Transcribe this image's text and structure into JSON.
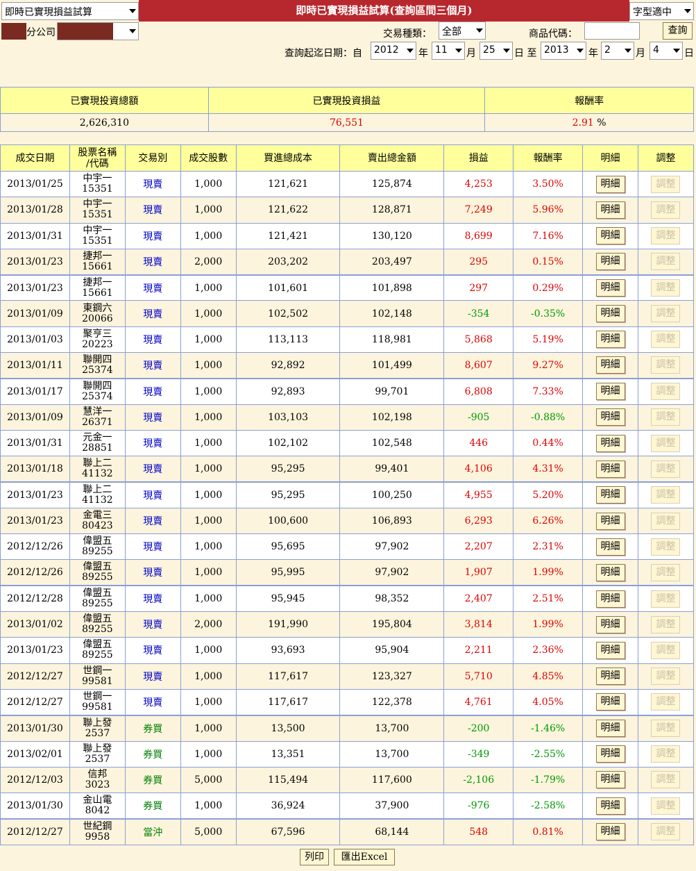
{
  "header": {
    "func_select": "即時已實現損益試算",
    "title": "即時已實現損益試算(查詢區間三個月)",
    "font_select": "字型適中",
    "branch_suffix": "分公司",
    "trade_type_label": "交易種類：",
    "trade_type_value": "全部",
    "product_code_label": "商品代碼：",
    "product_code_value": "",
    "query_button": "查詢",
    "date_label": "查詢起迄日期：自",
    "from_year": "2012",
    "year_unit_1": "年",
    "from_month": "11",
    "month_unit_1": "月",
    "from_day": "25",
    "day_unit_1": "日 至",
    "to_year": "2013",
    "year_unit_2": "年",
    "to_month": "2",
    "month_unit_2": "月",
    "to_day": "4",
    "day_unit_2": "日"
  },
  "summary": {
    "h_total": "已實現投資總額",
    "h_pl": "已實現投資損益",
    "h_rate": "報酬率",
    "total": "2,626,310",
    "pl": "76,551",
    "rate": "2.91",
    "rate_unit": "%"
  },
  "table": {
    "headers": [
      "成交日期",
      "股票名稱\n/代碼",
      "交易別",
      "成交股數",
      "買進總成本",
      "賣出總金額",
      "損益",
      "報酬率",
      "明細",
      "調整"
    ],
    "detail_label": "明細",
    "adjust_label": "調整",
    "rows": [
      [
        "2013/01/25",
        "中宇一",
        "15351",
        "現賣",
        "1,000",
        "121,621",
        "125,874",
        "4,253",
        "3.50%",
        "up"
      ],
      [
        "2013/01/28",
        "中宇一",
        "15351",
        "現賣",
        "1,000",
        "121,622",
        "128,871",
        "7,249",
        "5.96%",
        "up"
      ],
      [
        "2013/01/31",
        "中宇一",
        "15351",
        "現賣",
        "1,000",
        "121,421",
        "130,120",
        "8,699",
        "7.16%",
        "up"
      ],
      [
        "2013/01/23",
        "捷邦一",
        "15661",
        "現賣",
        "2,000",
        "203,202",
        "203,497",
        "295",
        "0.15%",
        "up"
      ],
      [
        "2013/01/23",
        "捷邦一",
        "15661",
        "現賣",
        "1,000",
        "101,601",
        "101,898",
        "297",
        "0.29%",
        "up"
      ],
      [
        "2013/01/09",
        "東鋼六",
        "20066",
        "現賣",
        "1,000",
        "102,502",
        "102,148",
        "-354",
        "-0.35%",
        "down"
      ],
      [
        "2013/01/03",
        "聚亨三",
        "20223",
        "現賣",
        "1,000",
        "113,113",
        "118,981",
        "5,868",
        "5.19%",
        "up"
      ],
      [
        "2013/01/11",
        "聯開四",
        "25374",
        "現賣",
        "1,000",
        "92,892",
        "101,499",
        "8,607",
        "9.27%",
        "up"
      ],
      [
        "2013/01/17",
        "聯開四",
        "25374",
        "現賣",
        "1,000",
        "92,893",
        "99,701",
        "6,808",
        "7.33%",
        "up"
      ],
      [
        "2013/01/09",
        "慧洋一",
        "26371",
        "現賣",
        "1,000",
        "103,103",
        "102,198",
        "-905",
        "-0.88%",
        "down"
      ],
      [
        "2013/01/31",
        "元金一",
        "28851",
        "現賣",
        "1,000",
        "102,102",
        "102,548",
        "446",
        "0.44%",
        "up"
      ],
      [
        "2013/01/18",
        "聯上二",
        "41132",
        "現賣",
        "1,000",
        "95,295",
        "99,401",
        "4,106",
        "4.31%",
        "up"
      ],
      [
        "2013/01/23",
        "聯上二",
        "41132",
        "現賣",
        "1,000",
        "95,295",
        "100,250",
        "4,955",
        "5.20%",
        "up"
      ],
      [
        "2013/01/23",
        "金電三",
        "80423",
        "現賣",
        "1,000",
        "100,600",
        "106,893",
        "6,293",
        "6.26%",
        "up"
      ],
      [
        "2012/12/26",
        "偉盟五",
        "89255",
        "現賣",
        "1,000",
        "95,695",
        "97,902",
        "2,207",
        "2.31%",
        "up"
      ],
      [
        "2012/12/26",
        "偉盟五",
        "89255",
        "現賣",
        "1,000",
        "95,995",
        "97,902",
        "1,907",
        "1.99%",
        "up"
      ],
      [
        "2012/12/28",
        "偉盟五",
        "89255",
        "現賣",
        "1,000",
        "95,945",
        "98,352",
        "2,407",
        "2.51%",
        "up"
      ],
      [
        "2013/01/02",
        "偉盟五",
        "89255",
        "現賣",
        "2,000",
        "191,990",
        "195,804",
        "3,814",
        "1.99%",
        "up"
      ],
      [
        "2013/01/23",
        "偉盟五",
        "89255",
        "現賣",
        "1,000",
        "93,693",
        "95,904",
        "2,211",
        "2.36%",
        "up"
      ],
      [
        "2012/12/27",
        "世鋼一",
        "99581",
        "現賣",
        "1,000",
        "117,617",
        "123,327",
        "5,710",
        "4.85%",
        "up"
      ],
      [
        "2012/12/27",
        "世鋼一",
        "99581",
        "現賣",
        "1,000",
        "117,617",
        "122,378",
        "4,761",
        "4.05%",
        "up"
      ],
      [
        "2013/01/30",
        "聯上發",
        "2537",
        "券買",
        "1,000",
        "13,500",
        "13,700",
        "-200",
        "-1.46%",
        "down"
      ],
      [
        "2013/02/01",
        "聯上發",
        "2537",
        "券買",
        "1,000",
        "13,351",
        "13,700",
        "-349",
        "-2.55%",
        "down"
      ],
      [
        "2012/12/03",
        "信邦",
        "3023",
        "券買",
        "5,000",
        "115,494",
        "117,600",
        "-2,106",
        "-1.79%",
        "down"
      ],
      [
        "2013/01/30",
        "金山電",
        "8042",
        "券買",
        "1,000",
        "36,924",
        "37,900",
        "-976",
        "-2.58%",
        "down"
      ],
      [
        "2012/12/27",
        "世紀鋼",
        "9958",
        "當沖",
        "5,000",
        "67,596",
        "68,144",
        "548",
        "0.81%",
        "up"
      ]
    ]
  },
  "footer": {
    "print_button": "列印",
    "export_button": "匯出Excel"
  },
  "colors": {
    "background": "#fcf4dc",
    "header_yellow": "#ffff9c",
    "title_red": "#b7282e",
    "gain": "#e00000",
    "loss": "#009900",
    "cash_sell": "#0000cc",
    "short_buy": "#008000",
    "border": "#8a9fd6"
  }
}
